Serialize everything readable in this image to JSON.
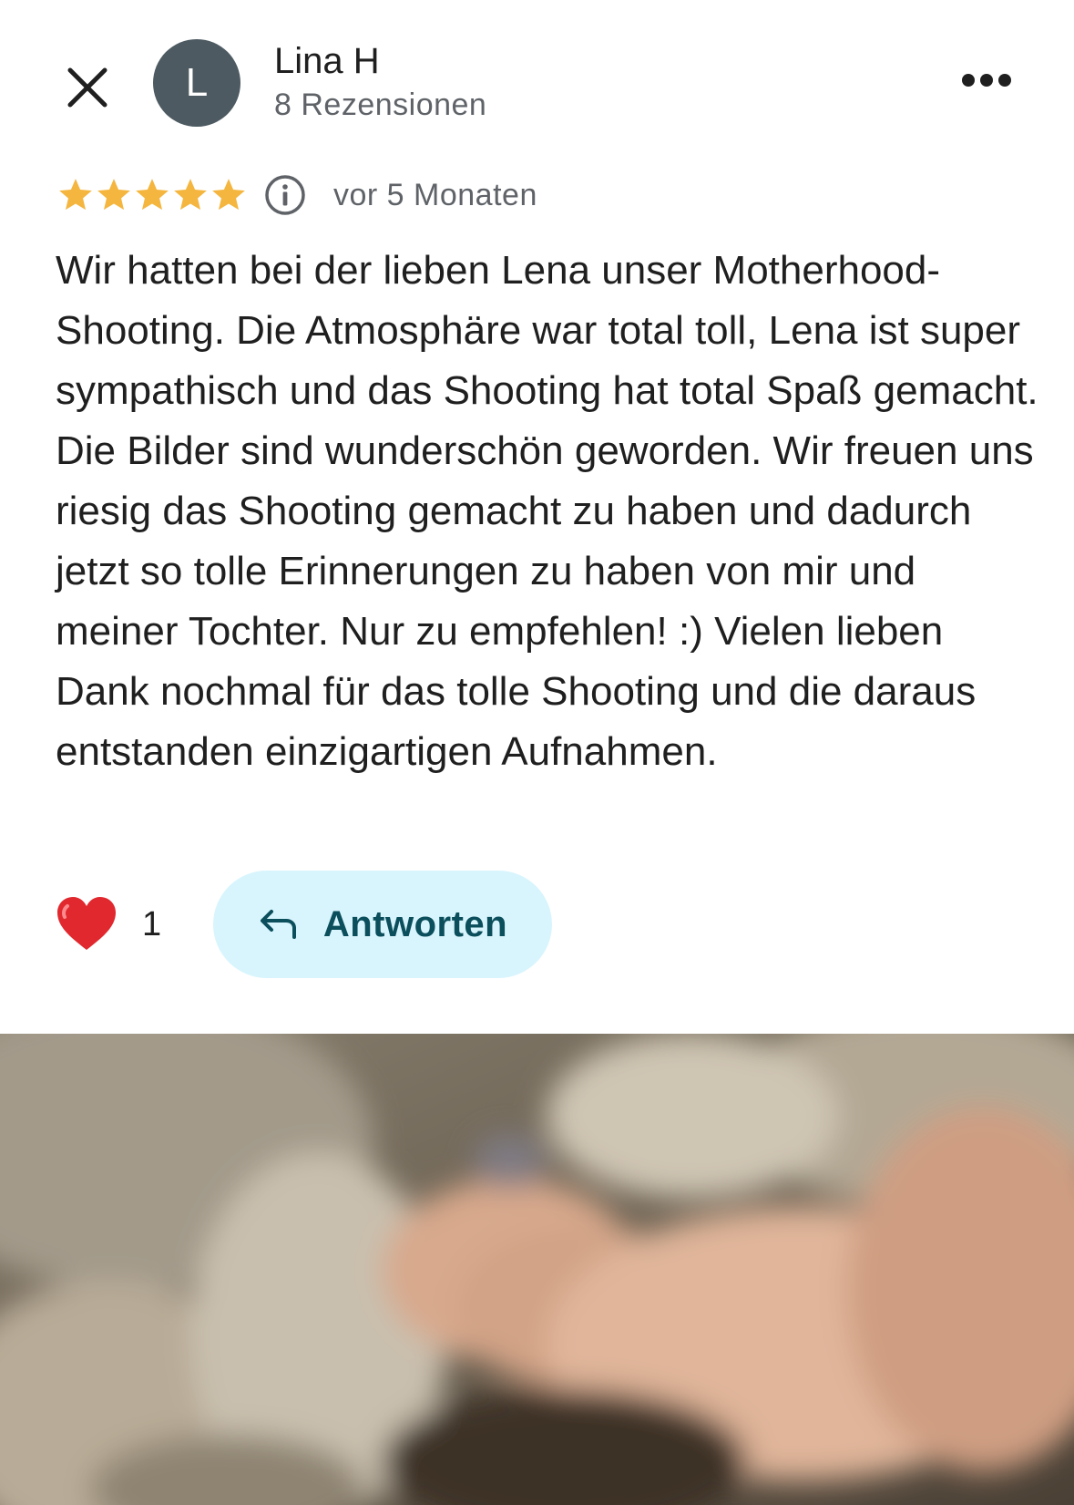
{
  "author": {
    "initial": "L",
    "name": "Lina H",
    "review_count": "8 Rezensionen"
  },
  "rating": {
    "stars": 5,
    "max_stars": 5,
    "date": "vor 5 Monaten"
  },
  "review": {
    "text": "Wir hatten bei der lieben Lena unser Motherhood-Shooting. Die Atmosphäre war total toll, Lena ist super sympathisch und das Shooting hat total Spaß gemacht. Die Bilder sind wunderschön geworden. Wir freuen uns riesig das Shooting gemacht zu haben und dadurch jetzt so tolle Erinnerungen zu haben von mir und meiner Tochter. Nur zu empfehlen! :) Vielen lieben Dank nochmal für das tolle Shooting und die daraus entstanden einzigartigen Aufnahmen."
  },
  "actions": {
    "like_count": "1",
    "reply_label": "Antworten"
  },
  "icons": {
    "close": "close-icon",
    "more": "more-horizontal-icon",
    "info": "info-icon",
    "heart": "heart-icon",
    "reply": "reply-arrow-icon",
    "star": "star-icon"
  },
  "colors": {
    "star": "#f4b63f",
    "avatar_bg": "#4d5a61",
    "reply_bg": "#d8f5fd",
    "reply_text": "#0b4e5c",
    "heart": "#e0282e"
  }
}
